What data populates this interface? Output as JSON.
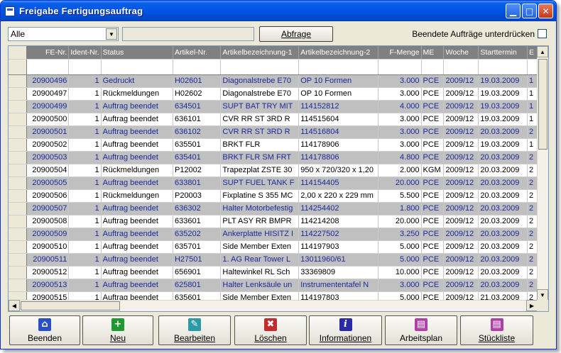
{
  "window": {
    "title": "Freigabe Fertigungsauftrag"
  },
  "toolbar": {
    "filter_value": "Alle",
    "query_button": "Abfrage",
    "finished_label": "Beendete Aufträge unterdrücken"
  },
  "table": {
    "columns": [
      "FE-Nr.",
      "Ident-Nr.",
      "Status",
      "Artikel-Nr.",
      "Artikelbezeichnung-1",
      "Artikelbezeichnung-2",
      "F-Menge",
      "ME",
      "Woche",
      "Starttermin",
      "E"
    ],
    "rows": [
      [
        "20900496",
        "1",
        "Gedruckt",
        "H02601",
        "Diagonalstrebe E70",
        "OP 10 Formen",
        "3.000",
        "PCE",
        "2009/12",
        "19.03.2009",
        "1"
      ],
      [
        "20900497",
        "1",
        "Rückmeldungen",
        "H02602",
        "Diagonalstrebe E70",
        "OP 10 Formen",
        "3.000",
        "PCE",
        "2009/12",
        "19.03.2009",
        "1"
      ],
      [
        "20900499",
        "1",
        "Auftrag beendet",
        "634501",
        "SUPT BAT TRY MIT",
        "114152812",
        "4.000",
        "PCE",
        "2009/12",
        "19.03.2009",
        "1"
      ],
      [
        "20900500",
        "1",
        "Auftrag beendet",
        "636101",
        "CVR RR ST 3RD R",
        "114515604",
        "3.000",
        "PCE",
        "2009/12",
        "19.03.2009",
        "1"
      ],
      [
        "20900501",
        "1",
        "Auftrag beendet",
        "636102",
        "CVR RR ST 3RD R",
        "114516804",
        "3.000",
        "PCE",
        "2009/12",
        "20.03.2009",
        "2"
      ],
      [
        "20900502",
        "1",
        "Auftrag beendet",
        "635501",
        "BRKT FLR",
        "114178906",
        "3.000",
        "PCE",
        "2009/12",
        "19.03.2009",
        "1"
      ],
      [
        "20900503",
        "1",
        "Auftrag beendet",
        "635401",
        "BRKT FLR SM FRT",
        "114178806",
        "4.800",
        "PCE",
        "2009/12",
        "20.03.2009",
        "2"
      ],
      [
        "20900504",
        "1",
        "Rückmeldungen",
        "P12002",
        "Trapezplat ZSTE 30",
        "950 x 720/320 x 1,20",
        "2.000",
        "KGM",
        "2009/12",
        "20.03.2009",
        "2"
      ],
      [
        "20900505",
        "1",
        "Auftrag beendet",
        "633801",
        "SUPT FUEL TANK F",
        "114154405",
        "20.000",
        "PCE",
        "2009/12",
        "20.03.2009",
        "2"
      ],
      [
        "20900506",
        "1",
        "Rückmeldungen",
        "P20003",
        "Fixplatine S 355 MC",
        "2,00 x 220 x 229 mm",
        "5.500",
        "PCE",
        "2009/12",
        "20.03.2009",
        "2"
      ],
      [
        "20900507",
        "1",
        "Auftrag beendet",
        "636302",
        "Halter Motorbefestig",
        "114254402",
        "1.800",
        "PCE",
        "2009/12",
        "20.03.2009",
        "2"
      ],
      [
        "20900508",
        "1",
        "Auftrag beendet",
        "633601",
        "PLT ASY RR BMPR",
        "114214208",
        "20.000",
        "PCE",
        "2009/12",
        "20.03.2009",
        "2"
      ],
      [
        "20900509",
        "1",
        "Auftrag beendet",
        "635202",
        "Ankerplatte HISITZ I",
        "114227502",
        "3.250",
        "PCE",
        "2009/12",
        "20.03.2009",
        "2"
      ],
      [
        "20900510",
        "1",
        "Auftrag beendet",
        "635701",
        "Side Member Exten",
        "114197903",
        "5.000",
        "PCE",
        "2009/12",
        "20.03.2009",
        "2"
      ],
      [
        "20900511",
        "1",
        "Auftrag beendet",
        "H27501",
        "1. AG Rear Tower L",
        "13011960/61",
        "5.000",
        "PCE",
        "2009/12",
        "20.03.2009",
        "2"
      ],
      [
        "20900512",
        "1",
        "Auftrag beendet",
        "656901",
        "Haltewinkel RL Sch",
        "33369809",
        "10.000",
        "PCE",
        "2009/12",
        "20.03.2009",
        "2"
      ],
      [
        "20900513",
        "1",
        "Auftrag beendet",
        "625801",
        "Halter Lenksäule un",
        "Instrumententafel N",
        "3.000",
        "PCE",
        "2009/12",
        "20.03.2009",
        "2"
      ],
      [
        "20900515",
        "1",
        "Auftrag beendet",
        "635601",
        "Side Member Exten",
        "114197803",
        "5.000",
        "PCE",
        "2009/12",
        "21.03.2009",
        "2"
      ]
    ]
  },
  "buttons": {
    "beenden": "Beenden",
    "neu": "Neu",
    "bearbeiten": "Bearbeiten",
    "loeschen": "Löschen",
    "informationen": "Informationen",
    "arbeitsplan": "Arbeitsplan",
    "stueckliste": "Stückliste"
  },
  "colors": {
    "alt_row_bg": "#c0c0c0",
    "alt_row_text": "#1b2a9b",
    "header_bg": "#808080",
    "titlebar": "#0055e5"
  }
}
